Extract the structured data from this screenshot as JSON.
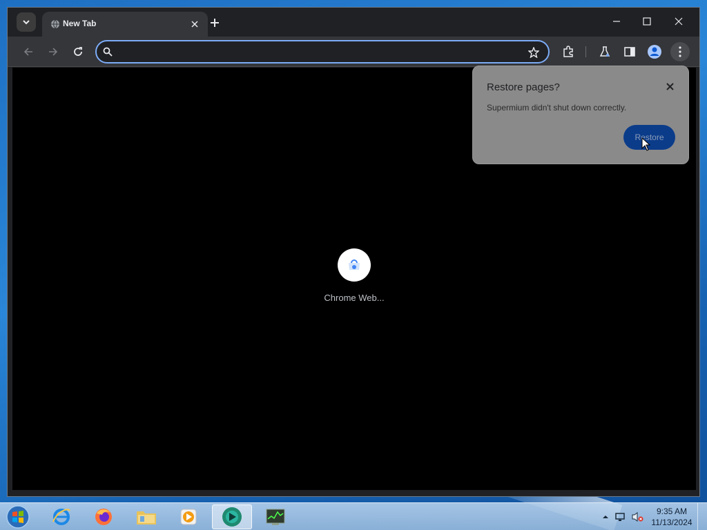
{
  "browser": {
    "tab": {
      "title": "New Tab",
      "favicon": "globe-icon"
    },
    "omnibox": {
      "value": "",
      "placeholder": ""
    },
    "icons": {
      "tab_search": "chevron-down-icon",
      "new_tab": "plus-icon",
      "back": "arrow-left-icon",
      "forward": "arrow-right-icon",
      "reload": "reload-icon",
      "bookmark": "star-icon",
      "extensions": "puzzle-icon",
      "labs": "flask-icon",
      "side_panel": "side-panel-icon",
      "profile": "profile-icon",
      "menu": "kebab-menu-icon"
    }
  },
  "new_tab_page": {
    "shortcuts": [
      {
        "label": "Chrome Web...",
        "icon": "chrome-web-store-icon"
      }
    ]
  },
  "restore_bubble": {
    "title": "Restore pages?",
    "message": "Supermium didn't shut down correctly.",
    "button_label": "Restore"
  },
  "taskbar": {
    "items": [
      {
        "name": "internet-explorer"
      },
      {
        "name": "firefox"
      },
      {
        "name": "file-explorer"
      },
      {
        "name": "media-player"
      },
      {
        "name": "supermium",
        "active": true
      },
      {
        "name": "task-manager"
      }
    ],
    "clock": {
      "time": "9:35 AM",
      "date": "11/13/2024"
    }
  },
  "colors": {
    "accent": "#7cacf8",
    "restore_button": "#0b3c8a",
    "toolbar": "#35363a",
    "frame": "#202124"
  }
}
